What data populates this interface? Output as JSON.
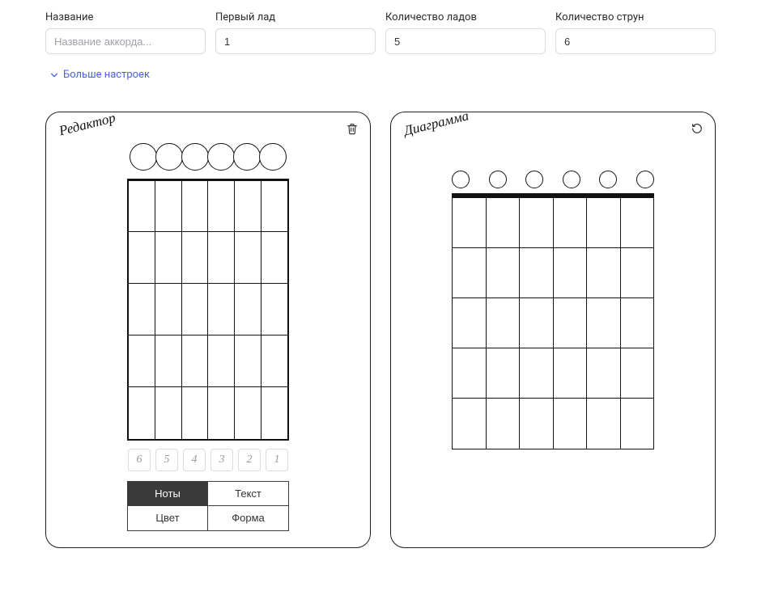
{
  "params": {
    "name": {
      "label": "Название",
      "value": "",
      "placeholder": "Название аккорда..."
    },
    "first_fret": {
      "label": "Первый лад",
      "value": "1"
    },
    "num_frets": {
      "label": "Количество ладов",
      "value": "5"
    },
    "num_strings": {
      "label": "Количество струн",
      "value": "6"
    }
  },
  "more_settings_label": "Больше настроек",
  "editor": {
    "title": "Редактор",
    "open_strings": 6,
    "frets": 5,
    "strings": 6,
    "tuning": [
      "6",
      "5",
      "4",
      "3",
      "2",
      "1"
    ],
    "tabs": {
      "notes": "Ноты",
      "text": "Текст",
      "color": "Цвет",
      "shape": "Форма",
      "active": "notes"
    }
  },
  "diagram": {
    "title": "Диаграмма",
    "open_strings": 6,
    "frets": 5,
    "strings": 6
  }
}
